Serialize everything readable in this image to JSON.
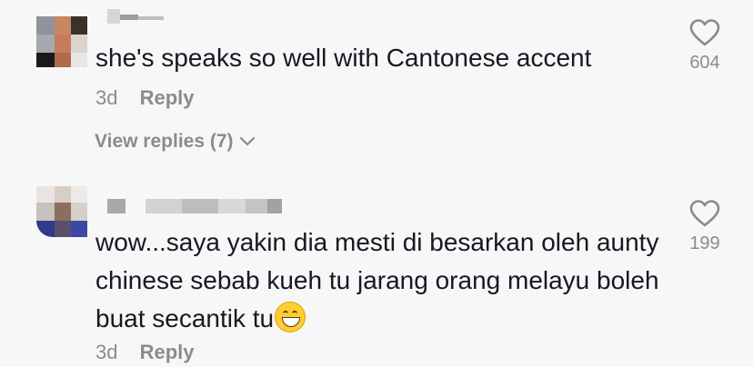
{
  "comments": [
    {
      "text": "she's speaks so well with Cantonese accent",
      "time": "3d",
      "reply_label": "Reply",
      "view_replies_label": "View replies (7)",
      "like_count": "604",
      "username_note": "pixelated"
    },
    {
      "text": "wow...saya yakin dia mesti di besarkan oleh aunty chinese sebab kueh tu jarang orang melayu boleh buat secantik tu",
      "emoji": "grinning-face-emoji",
      "time": "3d",
      "reply_label": "Reply",
      "like_count": "199",
      "username_note": "pixelated"
    }
  ],
  "colors": {
    "background": "#f7f7f7",
    "text": "#161823",
    "muted": "#8a8b91"
  },
  "icons": {
    "like": "heart-outline-icon",
    "expand": "chevron-down-icon"
  }
}
